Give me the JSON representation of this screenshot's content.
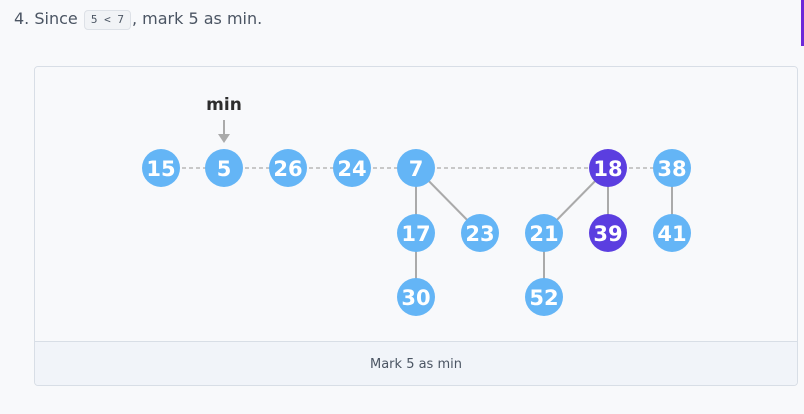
{
  "step": {
    "prefix": "4. Since",
    "code": "5 < 7",
    "suffix": ", mark 5 as min."
  },
  "diagram": {
    "min_marker_label": "min",
    "min_target": "5",
    "root_list": [
      "15",
      "5",
      "26",
      "24",
      "7",
      "18",
      "38"
    ],
    "nodes": [
      {
        "id": "n15",
        "label": "15",
        "color": "#64b5f6"
      },
      {
        "id": "n5",
        "label": "5",
        "color": "#64b5f6"
      },
      {
        "id": "n26",
        "label": "26",
        "color": "#64b5f6"
      },
      {
        "id": "n24",
        "label": "24",
        "color": "#64b5f6"
      },
      {
        "id": "n7",
        "label": "7",
        "color": "#64b5f6"
      },
      {
        "id": "n18",
        "label": "18",
        "color": "#5b3ee0"
      },
      {
        "id": "n38",
        "label": "38",
        "color": "#64b5f6"
      },
      {
        "id": "n17",
        "label": "17",
        "color": "#64b5f6"
      },
      {
        "id": "n23",
        "label": "23",
        "color": "#64b5f6"
      },
      {
        "id": "n21",
        "label": "21",
        "color": "#64b5f6"
      },
      {
        "id": "n39",
        "label": "39",
        "color": "#5b3ee0"
      },
      {
        "id": "n41",
        "label": "41",
        "color": "#64b5f6"
      },
      {
        "id": "n30",
        "label": "30",
        "color": "#64b5f6"
      },
      {
        "id": "n52",
        "label": "52",
        "color": "#64b5f6"
      }
    ],
    "tree_edges": [
      [
        "7",
        "17"
      ],
      [
        "7",
        "23"
      ],
      [
        "17",
        "30"
      ],
      [
        "18",
        "21"
      ],
      [
        "18",
        "39"
      ],
      [
        "21",
        "52"
      ],
      [
        "38",
        "41"
      ]
    ]
  },
  "caption": "Mark 5 as min",
  "colors": {
    "node_default": "#64b5f6",
    "node_marked": "#5b3ee0",
    "edge": "#aaaaaa",
    "accent": "#6d28d9"
  }
}
